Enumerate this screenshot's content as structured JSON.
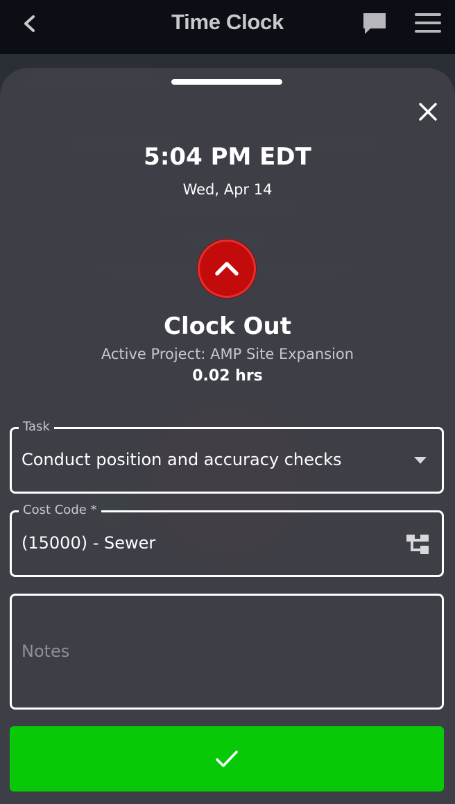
{
  "app_bar": {
    "title": "Time Clock",
    "icons": [
      "chevron-left-icon",
      "chat-icon",
      "hamburger-menu-icon"
    ]
  },
  "sheet": {
    "time": "5:04 PM EDT",
    "date": "Wed, Apr 14",
    "action_title": "Clock Out",
    "active_project": "Active Project: AMP Site Expansion",
    "hours": "0.02 hrs",
    "button_color": "#c40b0b",
    "task": {
      "label": "Task",
      "value": "Conduct position and accuracy checks"
    },
    "cost_code": {
      "label": "Cost Code *",
      "value": "(15000) - Sewer"
    },
    "notes": {
      "placeholder": "Notes",
      "value": ""
    },
    "confirm_color": "#08c908"
  }
}
